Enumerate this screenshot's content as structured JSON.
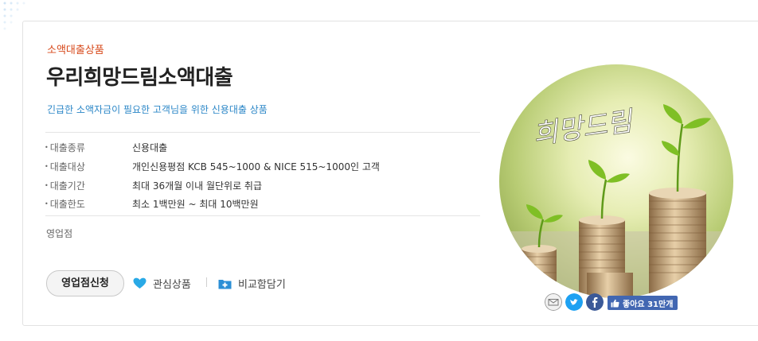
{
  "product": {
    "category": "소액대출상품",
    "title": "우리희망드림소액대출",
    "description": "긴급한 소액자금이 필요한 고객님을 위한 신용대출 상품"
  },
  "details": [
    {
      "label": "대출종류",
      "value": "신용대출"
    },
    {
      "label": "대출대상",
      "value": "개인신용평점 KCB 545~1000 & NICE 515~1000인 고객"
    },
    {
      "label": "대출기간",
      "value": "최대 36개월 이내 월단위로 취급"
    },
    {
      "label": "대출한도",
      "value": "최소 1백만원 ~ 최대 10백만원"
    }
  ],
  "branch_label": "영업점",
  "actions": {
    "apply": "영업점신청",
    "favorite": "관심상품",
    "compare": "비교함담기"
  },
  "banner": {
    "text": "희망드림"
  },
  "social": {
    "icons": [
      "mail-icon",
      "twitter-icon",
      "facebook-icon"
    ],
    "like_label": "좋아요 31만개"
  },
  "colors": {
    "category": "#d7491b",
    "description": "#2a86c7",
    "favorite_heart": "#29a9e6",
    "compare_icon": "#2b8fd6",
    "twitter": "#1da1f2",
    "facebook": "#3b5998",
    "like_button": "#4267b2"
  }
}
